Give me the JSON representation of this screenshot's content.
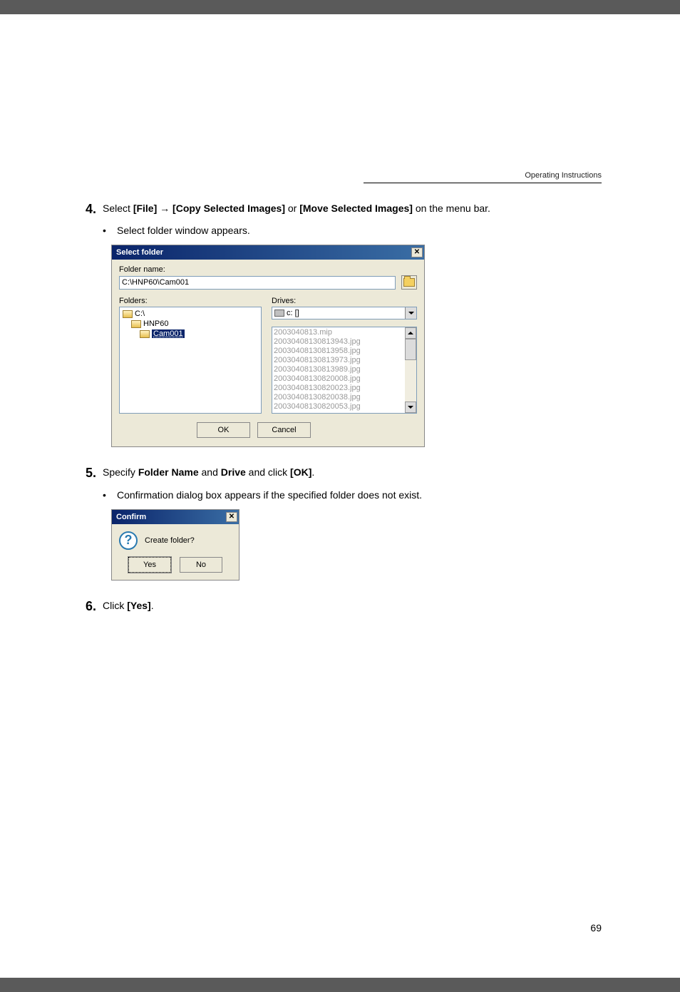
{
  "header": {
    "label": "Operating Instructions"
  },
  "steps": {
    "s4": {
      "num": "4.",
      "prefix": "Select ",
      "b1": "[File]",
      "arrow": " → ",
      "b2": "[Copy Selected Images]",
      "mid": " or ",
      "b3": "[Move Selected Images]",
      "suffix": " on the menu bar.",
      "bullet": "Select folder window appears."
    },
    "s5": {
      "num": "5.",
      "prefix": "Specify ",
      "b1": "Folder Name",
      "mid1": " and ",
      "b2": "Drive",
      "mid2": " and click ",
      "b3": "[OK]",
      "suffix": ".",
      "bullet": "Confirmation dialog box appears if the specified folder does not exist."
    },
    "s6": {
      "num": "6.",
      "prefix": "Click ",
      "b1": "[Yes]",
      "suffix": "."
    }
  },
  "select_dialog": {
    "title": "Select folder",
    "folder_name_label": "Folder name:",
    "folder_name_value": "C:\\HNP60\\Cam001",
    "folders_label": "Folders:",
    "tree": {
      "n0": "C:\\",
      "n1": "HNP60",
      "n2": "Cam001"
    },
    "drives_label": "Drives:",
    "drive_value": "c: []",
    "files": [
      "2003040813.mip",
      "20030408130813943.jpg",
      "20030408130813958.jpg",
      "20030408130813973.jpg",
      "20030408130813989.jpg",
      "20030408130820008.jpg",
      "20030408130820023.jpg",
      "20030408130820038.jpg",
      "20030408130820053.jpg"
    ],
    "ok": "OK",
    "cancel": "Cancel"
  },
  "confirm_dialog": {
    "title": "Confirm",
    "message": "Create folder?",
    "yes": "Yes",
    "no": "No"
  },
  "page_number": "69"
}
